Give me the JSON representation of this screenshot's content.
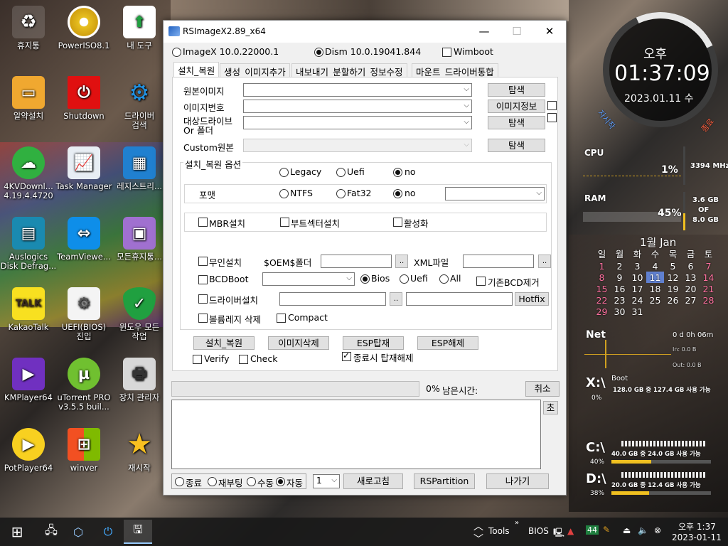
{
  "desktop": {
    "icons": [
      {
        "label": "휴지통",
        "icon": "recycle-bin-icon"
      },
      {
        "label": "PowerISO8.1",
        "icon": "poweriso-icon"
      },
      {
        "label": "내 도구",
        "icon": "tools-folder-icon"
      },
      {
        "label": "알약설치",
        "icon": "alyac-icon"
      },
      {
        "label": "Shutdown",
        "icon": "shutdown-icon"
      },
      {
        "label": "드라이버\n검색",
        "icon": "gear-icon"
      },
      {
        "label": "4KVDownl...\n4.19.4.4720",
        "icon": "download-cloud-icon"
      },
      {
        "label": "Task Manager",
        "icon": "task-manager-icon"
      },
      {
        "label": "레지스트리...",
        "icon": "registry-icon"
      },
      {
        "label": "Auslogics\nDisk Defrag...",
        "icon": "defrag-icon"
      },
      {
        "label": "TeamViewe...",
        "icon": "teamviewer-icon"
      },
      {
        "label": "모든휴지통...",
        "icon": "all-recycle-icon"
      },
      {
        "label": "KakaoTalk",
        "icon": "kakaotalk-icon"
      },
      {
        "label": "UEFI(BIOS)\n진입",
        "icon": "uefi-icon"
      },
      {
        "label": "윈도우 모든\n작업",
        "icon": "shield-check-icon"
      },
      {
        "label": "KMPlayer64",
        "icon": "kmplayer-icon"
      },
      {
        "label": "uTorrent PRO\nv3.5.5 buil...",
        "icon": "utorrent-icon"
      },
      {
        "label": "장치 관리자",
        "icon": "device-manager-icon"
      },
      {
        "label": "PotPlayer64",
        "icon": "potplayer-icon"
      },
      {
        "label": "winver",
        "icon": "windows-flag-icon"
      },
      {
        "label": "재시작",
        "icon": "star-icon"
      }
    ]
  },
  "window": {
    "title": "RSImageX2.89_x64",
    "mode": {
      "imagex_label": "ImageX 10.0.22000.1",
      "dism_label": "Dism 10.0.19041.844",
      "wimboot_label": "Wimboot"
    },
    "tabs": [
      "설치_복원",
      "생성_이미지추가",
      "내보내기_분할하기_정보수정",
      "마운트_드라이버통합"
    ],
    "form": {
      "source_label": "원본이미지",
      "index_label": "이미지번호",
      "target_label_1": "대상드라이브",
      "target_label_2": "Or 폴더",
      "custom_label": "Custom원본",
      "browse": "탐색",
      "image_info": "이미지정보"
    },
    "options": {
      "title": "설치_복원 옵션",
      "legacy": "Legacy",
      "uefi": "Uefi",
      "no": "no",
      "format_label": "포맷",
      "ntfs": "NTFS",
      "fat32": "Fat32",
      "mbr": "MBR설치",
      "bootsector": "부트섹터설치",
      "activate": "활성화",
      "unattended": "무인설치",
      "oem": "$OEM$폴더",
      "xml": "XML파일",
      "dots": "..",
      "bcdboot": "BCDBoot",
      "bios": "Bios",
      "uefi2": "Uefi",
      "all": "All",
      "keep_bcd": "기존BCD제거",
      "driver_install": "드라이버설치",
      "hotfix": "Hotfix",
      "vol_delete": "볼륨레지 삭제",
      "compact": "Compact"
    },
    "actions": {
      "install": "설치_복원",
      "delete_image": "이미지삭제",
      "esp_mount": "ESP탑재",
      "esp_unmount": "ESP해제",
      "verify": "Verify",
      "check": "Check",
      "unmount_on_exit": "종료시 탑재해제"
    },
    "progress": {
      "percent": "0%",
      "remaining_label": "남은시간:",
      "cancel": "취소",
      "clear": "초"
    },
    "footer": {
      "shutdown": "종료",
      "reboot": "재부팅",
      "manual": "수동",
      "auto": "자동",
      "count": "1",
      "refresh": "새로고침",
      "rspartition": "RSPartition",
      "exit": "나가기"
    }
  },
  "widgets": {
    "clock": {
      "ampm": "오후",
      "time": "01:37:09",
      "date": "2023.01.11 수",
      "left_btn": "자시작",
      "right_btn": "종료"
    },
    "cpu": {
      "label": "CPU",
      "value": "1%",
      "freq": "3394 MHz"
    },
    "ram": {
      "label": "RAM",
      "value": "45%",
      "size_1": "3.6 GB",
      "size_2": "OF",
      "size_3": "8.0 GB"
    },
    "calendar": {
      "title": "1월 Jan",
      "weekdays": [
        "일",
        "월",
        "화",
        "수",
        "목",
        "금",
        "토"
      ],
      "weeks": [
        [
          "1",
          "2",
          "3",
          "4",
          "5",
          "6",
          "7"
        ],
        [
          "8",
          "9",
          "10",
          "11",
          "12",
          "13",
          "14"
        ],
        [
          "15",
          "16",
          "17",
          "18",
          "19",
          "20",
          "21"
        ],
        [
          "22",
          "23",
          "24",
          "25",
          "26",
          "27",
          "28"
        ],
        [
          "29",
          "30",
          "31",
          "",
          "",
          "",
          ""
        ]
      ],
      "today": "11"
    },
    "net": {
      "label": "Net",
      "uptime": "0 d 0h 06m",
      "in": "In: 0.0 B",
      "out": "Out: 0.0 B"
    },
    "drives": [
      {
        "letter": "X:\\",
        "name": "Boot",
        "info": "128.0 GB 중  127.4 GB 사용 가능",
        "pct": "0%",
        "fill": 0.0
      },
      {
        "letter": "C:\\",
        "name": "",
        "info": "40.0 GB 중   24.0 GB 사용 가능",
        "pct": "40%",
        "fill": 0.4
      },
      {
        "letter": "D:\\",
        "name": "",
        "info": "20.0 GB 중   12.4 GB 사용 가능",
        "pct": "38%",
        "fill": 0.38
      }
    ]
  },
  "taskbar": {
    "tools": "Tools",
    "bios": "BIOS",
    "badge": "44",
    "time": "오후 1:37",
    "date": "2023-01-11"
  }
}
